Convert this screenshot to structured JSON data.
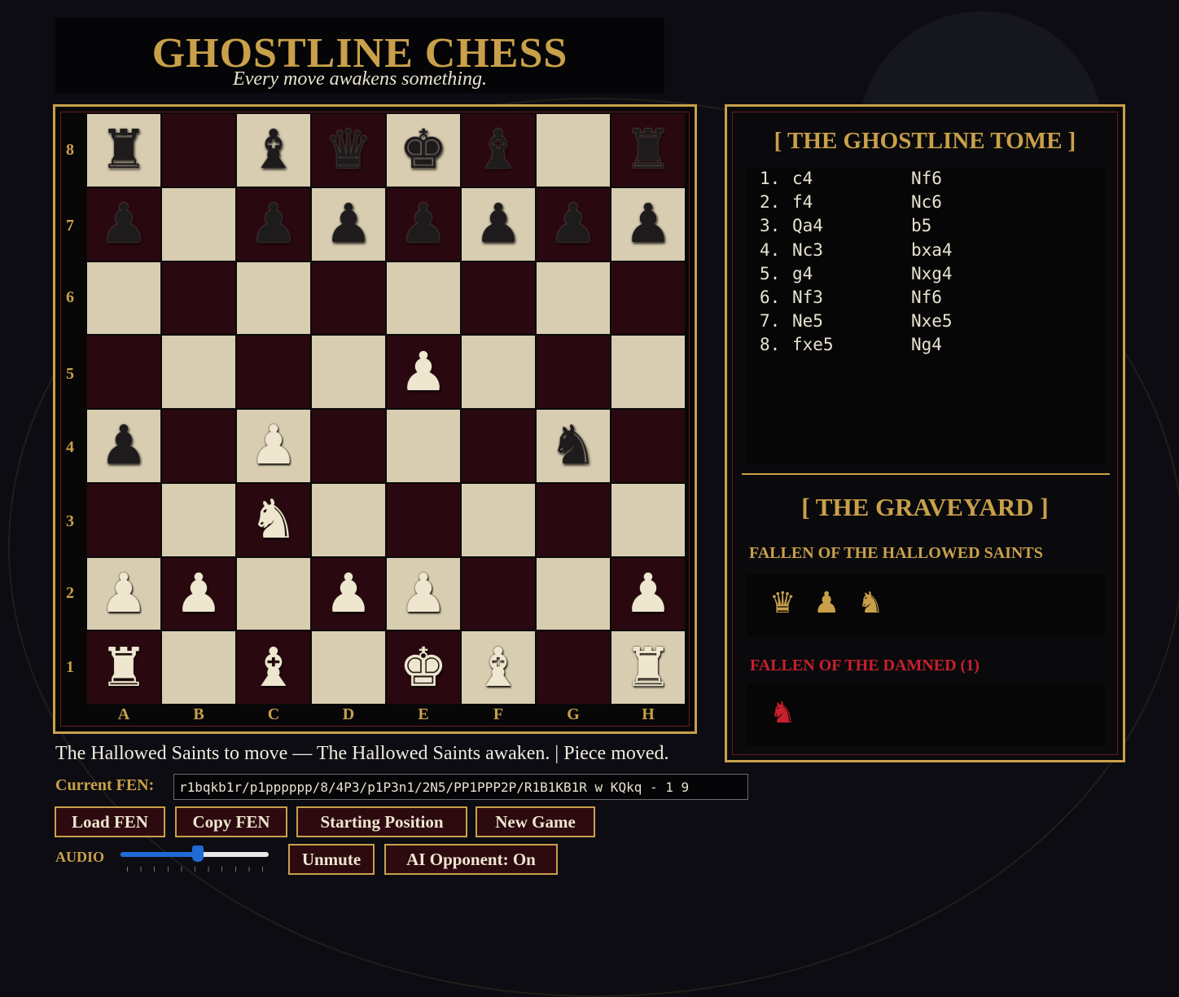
{
  "header": {
    "title": "GHOSTLINE CHESS",
    "subtitle": "Every move awakens something."
  },
  "board": {
    "ranks": [
      "8",
      "7",
      "6",
      "5",
      "4",
      "3",
      "2",
      "1"
    ],
    "files": [
      "A",
      "B",
      "C",
      "D",
      "E",
      "F",
      "G",
      "H"
    ],
    "squares": [
      [
        "br",
        "",
        "bb",
        "bq",
        "bk",
        "bb",
        "",
        "br"
      ],
      [
        "bp",
        "",
        "bp",
        "bp",
        "bp",
        "bp",
        "bp",
        "bp"
      ],
      [
        "",
        "",
        "",
        "",
        "",
        "",
        "",
        ""
      ],
      [
        "",
        "",
        "",
        "",
        "wp",
        "",
        "",
        ""
      ],
      [
        "bp",
        "",
        "wp",
        "",
        "",
        "",
        "bn",
        ""
      ],
      [
        "",
        "",
        "wn",
        "",
        "",
        "",
        "",
        ""
      ],
      [
        "wp",
        "wp",
        "",
        "wp",
        "wp",
        "",
        "",
        "wp"
      ],
      [
        "wr",
        "",
        "wb",
        "",
        "wk",
        "wb",
        "",
        "wr"
      ]
    ],
    "light_color": "#d8cdb0",
    "dark_color": "#2a0810"
  },
  "tome": {
    "title": "[ THE GHOSTLINE TOME ]",
    "moves": [
      {
        "num": "1.",
        "white": "c4",
        "black": "Nf6"
      },
      {
        "num": "2.",
        "white": "f4",
        "black": "Nc6"
      },
      {
        "num": "3.",
        "white": "Qa4",
        "black": "b5"
      },
      {
        "num": "4.",
        "white": "Nc3",
        "black": "bxa4"
      },
      {
        "num": "5.",
        "white": "g4",
        "black": "Nxg4"
      },
      {
        "num": "6.",
        "white": "Nf3",
        "black": "Nf6"
      },
      {
        "num": "7.",
        "white": "Ne5",
        "black": "Nxe5"
      },
      {
        "num": "8.",
        "white": "fxe5",
        "black": "Ng4"
      }
    ]
  },
  "graveyard": {
    "title": "[ THE GRAVEYARD ]",
    "saints_label": "FALLEN OF THE HALLOWED SAINTS",
    "saints_pieces": [
      "queen-icon",
      "pawn-icon",
      "knight-icon"
    ],
    "damned_label": "FALLEN OF THE DAMNED (1)",
    "damned_pieces": [
      "knight-icon"
    ]
  },
  "status": "The Hallowed Saints to move — The Hallowed Saints awaken. | Piece moved.",
  "fen": {
    "label": "Current FEN:",
    "value": "r1bqkb1r/p1pppppp/8/4P3/p1P3n1/2N5/PP1PPP2P/R1B1KB1R w KQkq - 1 9"
  },
  "buttons": {
    "load_fen": "Load FEN",
    "copy_fen": "Copy FEN",
    "starting_position": "Starting Position",
    "new_game": "New Game",
    "unmute": "Unmute",
    "ai_opponent": "AI Opponent: On"
  },
  "audio": {
    "label": "AUDIO",
    "volume": 0.52
  },
  "colors": {
    "gold": "#c9a04a",
    "crimson": "#c8202c",
    "button_bg": "#2c0a0f"
  }
}
